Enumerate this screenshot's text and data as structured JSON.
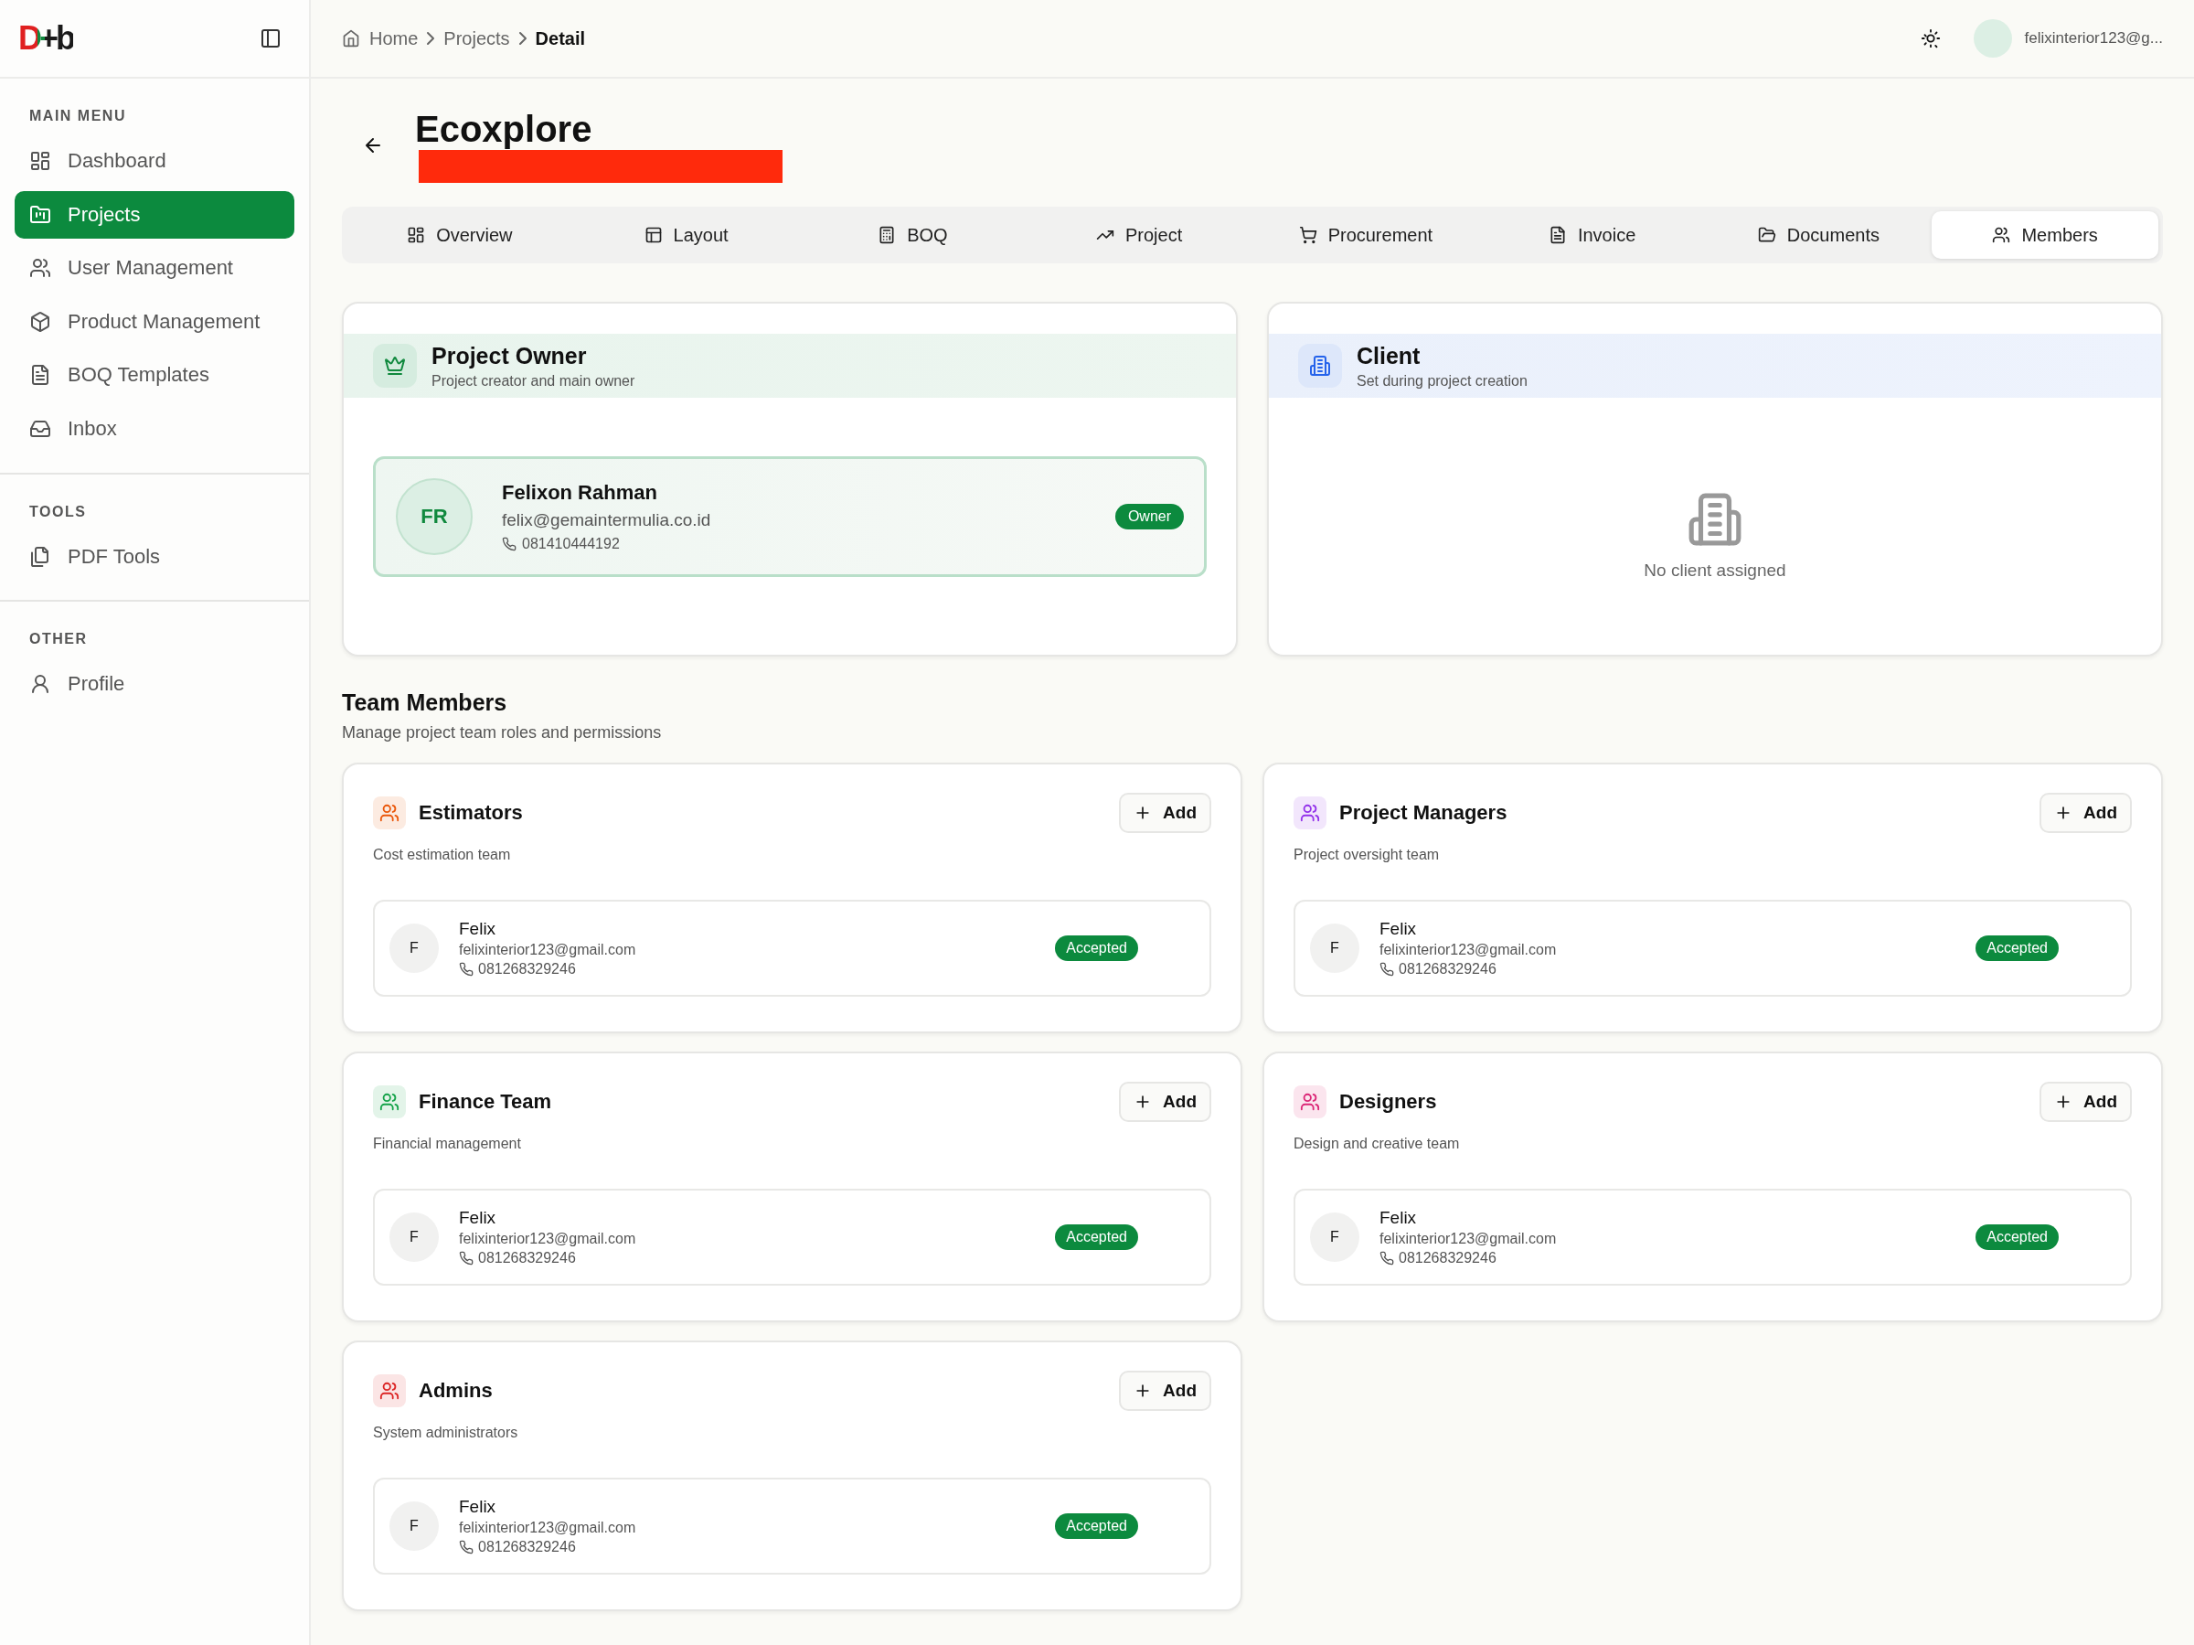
{
  "sidebar": {
    "logo": "D+b",
    "sections": [
      {
        "title": "MAIN MENU",
        "items": [
          {
            "label": "Dashboard",
            "selected": false
          },
          {
            "label": "Projects",
            "selected": true
          },
          {
            "label": "User Management",
            "selected": false
          },
          {
            "label": "Product Management",
            "selected": false
          },
          {
            "label": "BOQ Templates",
            "selected": false
          },
          {
            "label": "Inbox",
            "selected": false
          }
        ]
      },
      {
        "title": "TOOLS",
        "items": [
          {
            "label": "PDF Tools",
            "selected": false
          }
        ]
      },
      {
        "title": "OTHER",
        "items": [
          {
            "label": "Profile",
            "selected": false
          }
        ]
      }
    ]
  },
  "header": {
    "breadcrumb": [
      "Home",
      "Projects",
      "Detail"
    ],
    "user": "felixinterior123@g..."
  },
  "project": {
    "title": "Ecoxplore"
  },
  "tabs": [
    {
      "label": "Overview",
      "selected": false
    },
    {
      "label": "Layout",
      "selected": false
    },
    {
      "label": "BOQ",
      "selected": false
    },
    {
      "label": "Project",
      "selected": false
    },
    {
      "label": "Procurement",
      "selected": false
    },
    {
      "label": "Invoice",
      "selected": false
    },
    {
      "label": "Documents",
      "selected": false
    },
    {
      "label": "Members",
      "selected": true
    }
  ],
  "owner_card": {
    "title": "Project Owner",
    "subtitle": "Project creator and main owner",
    "owner": {
      "initials": "FR",
      "name": "Felixon Rahman",
      "email": "felix@gemaintermulia.co.id",
      "phone": "081410444192",
      "badge": "Owner"
    }
  },
  "client_card": {
    "title": "Client",
    "subtitle": "Set during project creation",
    "empty_text": "No client assigned"
  },
  "team": {
    "title": "Team Members",
    "subtitle": "Manage project team roles and permissions",
    "groups": [
      {
        "title": "Estimators",
        "description": "Cost estimation team",
        "color": "#ea580c",
        "add_label": "Add",
        "members": [
          {
            "initial": "F",
            "name": "Felix",
            "email": "felixinterior123@gmail.com",
            "phone": "081268329246",
            "status": "Accepted"
          }
        ]
      },
      {
        "title": "Project Managers",
        "description": "Project oversight team",
        "color": "#9333ea",
        "add_label": "Add",
        "members": [
          {
            "initial": "F",
            "name": "Felix",
            "email": "felixinterior123@gmail.com",
            "phone": "081268329246",
            "status": "Accepted"
          }
        ]
      },
      {
        "title": "Finance Team",
        "description": "Financial management",
        "color": "#16a34a",
        "add_label": "Add",
        "members": [
          {
            "initial": "F",
            "name": "Felix",
            "email": "felixinterior123@gmail.com",
            "phone": "081268329246",
            "status": "Accepted"
          }
        ]
      },
      {
        "title": "Designers",
        "description": "Design and creative team",
        "color": "#db2777",
        "add_label": "Add",
        "members": [
          {
            "initial": "F",
            "name": "Felix",
            "email": "felixinterior123@gmail.com",
            "phone": "081268329246",
            "status": "Accepted"
          }
        ]
      },
      {
        "title": "Admins",
        "description": "System administrators",
        "color": "#dc2626",
        "add_label": "Add",
        "members": [
          {
            "initial": "F",
            "name": "Felix",
            "email": "felixinterior123@gmail.com",
            "phone": "081268329246",
            "status": "Accepted"
          }
        ]
      }
    ]
  }
}
